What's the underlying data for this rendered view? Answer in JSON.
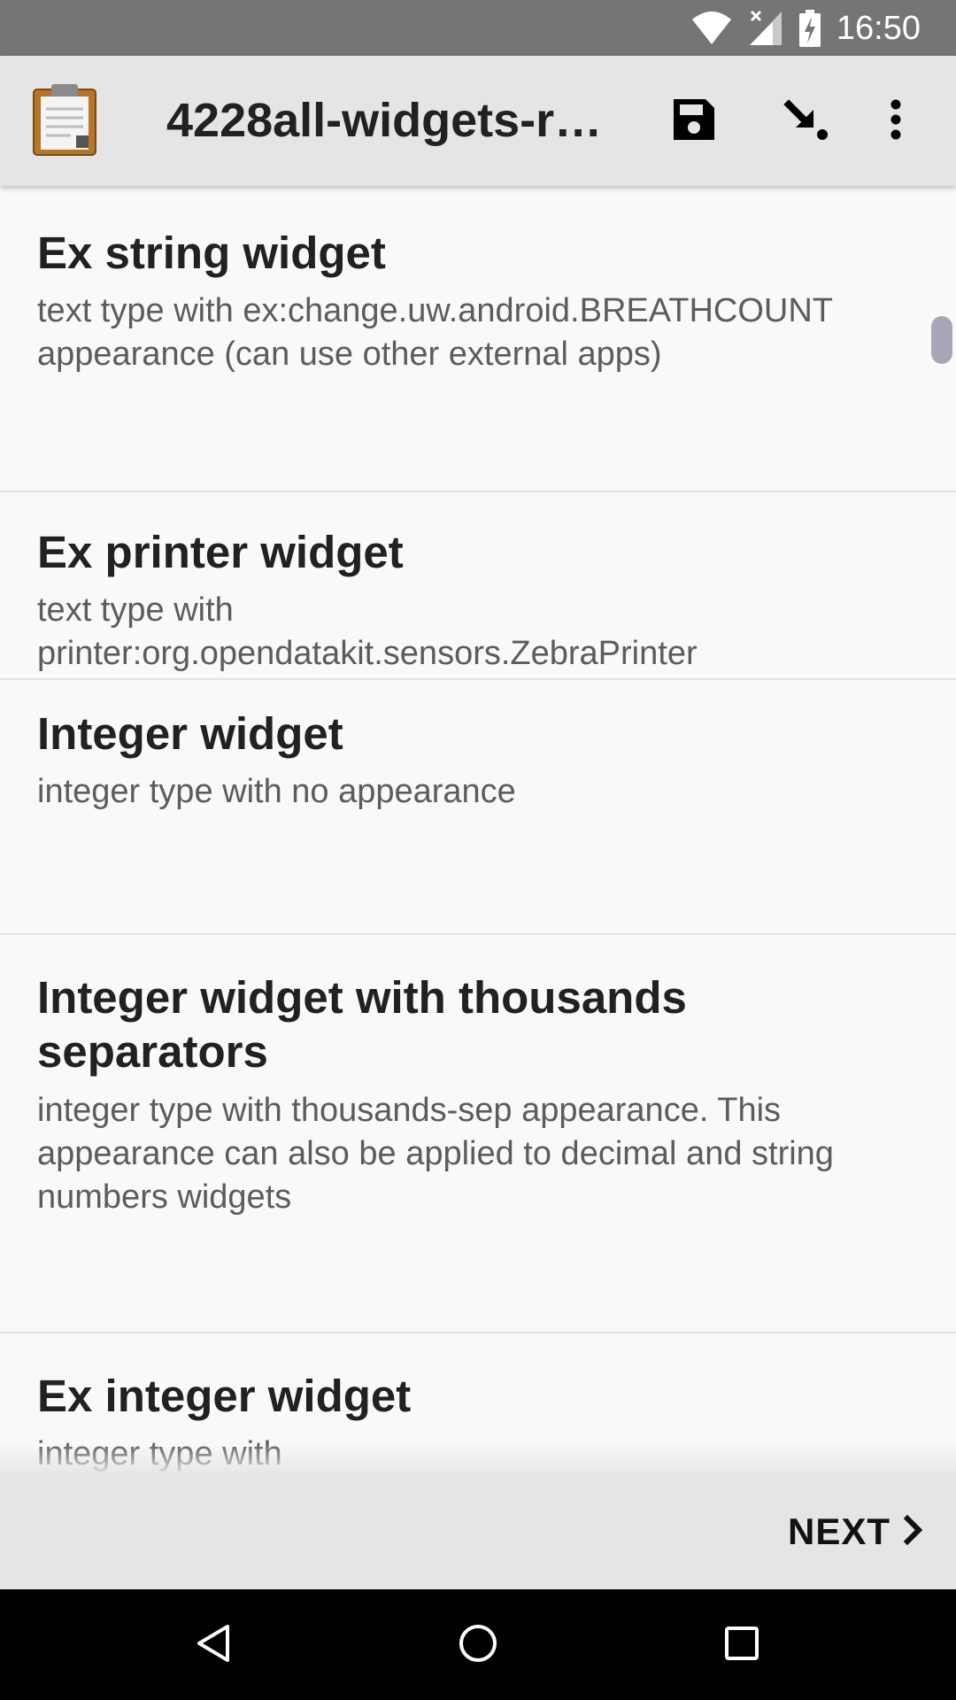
{
  "status_bar": {
    "time": "16:50",
    "icons": [
      "wifi-icon",
      "cell-signal-icon",
      "battery-charging-icon"
    ]
  },
  "app_bar": {
    "title": "4228all-widgets-re…",
    "actions": [
      "save-icon",
      "jump-to-icon",
      "more-vert-icon"
    ]
  },
  "questions": [
    {
      "label": "Ex string widget",
      "hint": "text type with ex:change.uw.android.BREATHCOUNT appearance (can use other external apps)"
    },
    {
      "label": "Ex printer widget",
      "hint": "text type with printer:org.opendatakit.sensors.ZebraPrinter"
    },
    {
      "label": "Integer widget",
      "hint": "integer type with no appearance"
    },
    {
      "label": "Integer widget with thousands separators",
      "hint": "integer type with thousands-sep appearance. This appearance can also be applied to decimal and string numbers widgets"
    },
    {
      "label": "Ex integer widget",
      "hint": "integer type with"
    }
  ],
  "footer": {
    "next_label": "NEXT"
  },
  "colors": {
    "status_bar": "#757575",
    "app_bar": "#e5e5e5",
    "background": "#f9f9f9",
    "scrollbar": "#a7a7b8"
  }
}
